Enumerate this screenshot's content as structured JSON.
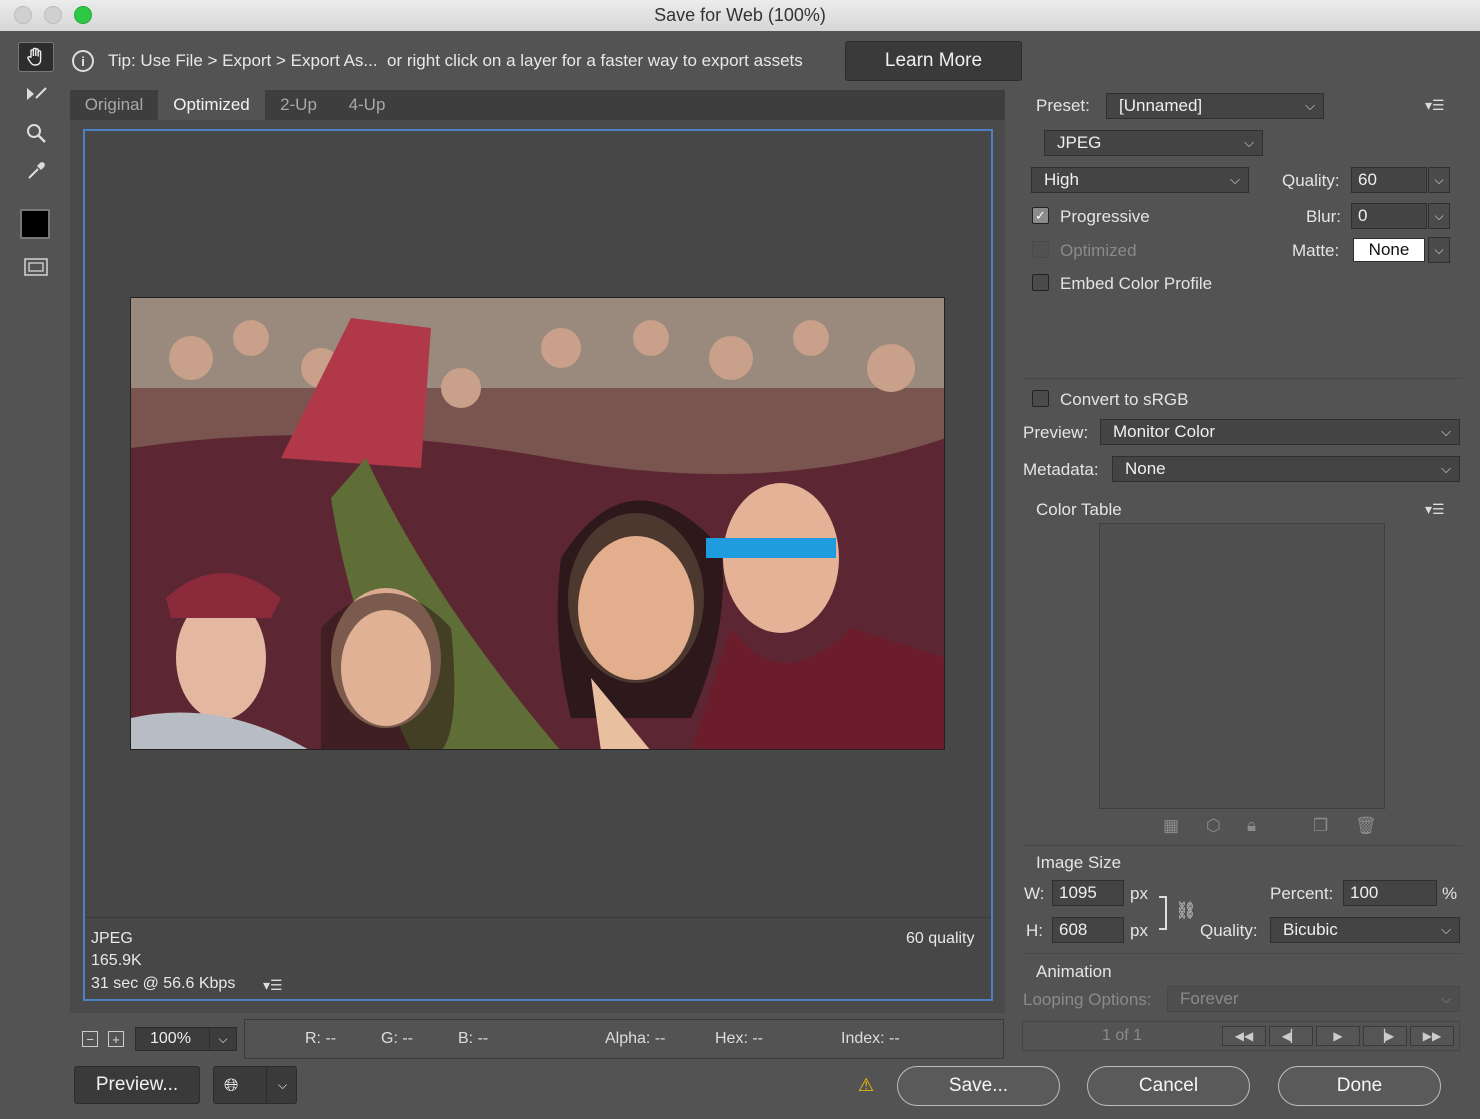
{
  "window": {
    "title": "Save for Web (100%)"
  },
  "tip": {
    "text": "Tip: Use File > Export > Export As...  or right click on a layer for a faster way to export assets",
    "learn_more": "Learn More"
  },
  "tools": [
    "hand-tool-icon",
    "slice-select-tool-icon",
    "zoom-tool-icon",
    "eyedropper-tool-icon"
  ],
  "tabs": [
    {
      "label": "Original",
      "active": false
    },
    {
      "label": "Optimized",
      "active": true
    },
    {
      "label": "2-Up",
      "active": false
    },
    {
      "label": "4-Up",
      "active": false
    }
  ],
  "canvas_info": {
    "format": "JPEG",
    "size": "165.9K",
    "time": "31 sec @ 56.6 Kbps",
    "quality": "60 quality"
  },
  "zoom": {
    "value": "100%"
  },
  "readouts": {
    "r": "R: --",
    "g": "G: --",
    "b": "B: --",
    "alpha": "Alpha: --",
    "hex": "Hex: --",
    "index": "Index: --"
  },
  "footer": {
    "preview": "Preview...",
    "save": "Save...",
    "cancel": "Cancel",
    "done": "Done",
    "warning": "⚠"
  },
  "settings": {
    "preset_label": "Preset:",
    "preset_value": "[Unnamed]",
    "format": "JPEG",
    "quality_level": "High",
    "quality_label": "Quality:",
    "quality_value": "60",
    "progressive_label": "Progressive",
    "progressive_checked": true,
    "blur_label": "Blur:",
    "blur_value": "0",
    "optimized_label": "Optimized",
    "matte_label": "Matte:",
    "matte_value": "None",
    "embed_label": "Embed Color Profile",
    "convert_label": "Convert to sRGB",
    "preview_label": "Preview:",
    "preview_value": "Monitor Color",
    "metadata_label": "Metadata:",
    "metadata_value": "None",
    "color_table_label": "Color Table"
  },
  "image_size": {
    "title": "Image Size",
    "w_label": "W:",
    "w_value": "1095",
    "h_label": "H:",
    "h_value": "608",
    "unit": "px",
    "percent_label": "Percent:",
    "percent_value": "100",
    "percent_unit": "%",
    "quality_label": "Quality:",
    "quality_value": "Bicubic"
  },
  "animation": {
    "title": "Animation",
    "looping_label": "Looping Options:",
    "looping_value": "Forever",
    "frame": "1 of 1"
  },
  "colors": {
    "background": "#535353",
    "selection_border": "#4b80c4",
    "traffic_green": "#2ec845",
    "warning": "#f2c200"
  }
}
